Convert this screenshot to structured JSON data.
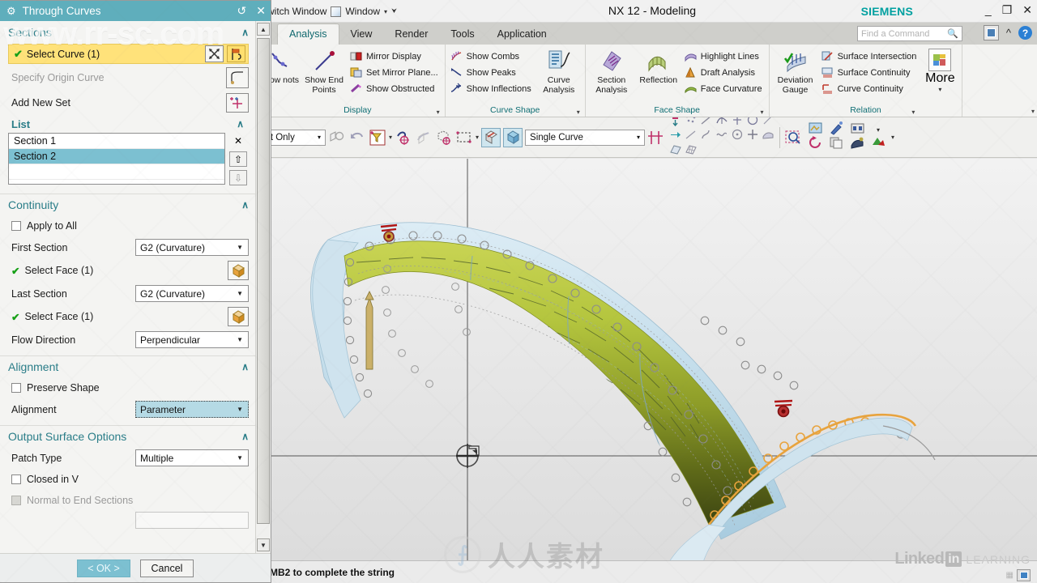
{
  "app": {
    "title": "NX 12 - Modeling",
    "brand": "SIEMENS",
    "minimize": "_",
    "restore": "❐",
    "close": "✕"
  },
  "quick_access": {
    "switch_window_label": "witch Window",
    "window_label": "Window",
    "dropdown_caret": "▾",
    "overflow_caret": "⮟"
  },
  "search": {
    "placeholder": "Find a Command",
    "icon": "search-icon"
  },
  "ribbon": {
    "tabs": [
      {
        "label": "Analysis",
        "active": true
      },
      {
        "label": "View",
        "active": false
      },
      {
        "label": "Render",
        "active": false
      },
      {
        "label": "Tools",
        "active": false
      },
      {
        "label": "Application",
        "active": false
      }
    ],
    "groups": [
      {
        "name": "Display",
        "big_buttons": [
          {
            "label": "how\nnots",
            "icon": "show-knots-icon"
          },
          {
            "label": "Show End\nPoints",
            "icon": "show-end-points-icon"
          }
        ],
        "small_buttons": [
          {
            "label": "Mirror Display",
            "icon": "mirror-display-icon"
          },
          {
            "label": "Set Mirror Plane...",
            "icon": "set-mirror-plane-icon"
          },
          {
            "label": "Show Obstructed",
            "icon": "show-obstructed-icon"
          }
        ]
      },
      {
        "name": "Curve Shape",
        "small_buttons": [
          {
            "label": "Show Combs",
            "icon": "show-combs-icon"
          },
          {
            "label": "Show Peaks",
            "icon": "show-peaks-icon"
          },
          {
            "label": "Show Inflections",
            "icon": "show-inflections-icon"
          }
        ],
        "big_buttons": [
          {
            "label": "Curve\nAnalysis",
            "icon": "curve-analysis-icon"
          }
        ]
      },
      {
        "name": "Face Shape",
        "big_buttons": [
          {
            "label": "Section\nAnalysis",
            "icon": "section-analysis-icon"
          },
          {
            "label": "Reflection",
            "icon": "reflection-icon"
          }
        ],
        "small_buttons": [
          {
            "label": "Highlight Lines",
            "icon": "highlight-lines-icon"
          },
          {
            "label": "Draft Analysis",
            "icon": "draft-analysis-icon"
          },
          {
            "label": "Face Curvature",
            "icon": "face-curvature-icon"
          }
        ]
      },
      {
        "name": "Relation",
        "big_buttons": [
          {
            "label": "Deviation\nGauge",
            "icon": "deviation-gauge-icon"
          }
        ],
        "small_buttons": [
          {
            "label": "Surface Intersection",
            "icon": "surface-intersection-icon"
          },
          {
            "label": "Surface Continuity",
            "icon": "surface-continuity-icon"
          },
          {
            "label": "Curve Continuity",
            "icon": "curve-continuity-icon"
          }
        ]
      }
    ],
    "more_label": "More",
    "group_expand_caret": "▾"
  },
  "toolbar": {
    "filter_value": "rt Only",
    "curve_rule_value": "Single Curve",
    "caret": "▾"
  },
  "dialog": {
    "title": "Through Curves",
    "title_icons": {
      "reset": "↺",
      "close": "✕",
      "gear": "⚙"
    },
    "sections": {
      "header": "Sections",
      "collapse_caret": "∧",
      "select_curve": {
        "label": "Select Curve (1)",
        "check": "✔"
      },
      "specify_origin_curve": "Specify Origin Curve",
      "add_new_set": "Add New Set",
      "list": {
        "header": "List",
        "collapse_caret": "∧",
        "items": [
          {
            "label": "Section  1",
            "selected": false
          },
          {
            "label": "Section  2",
            "selected": true
          }
        ],
        "buttons": [
          {
            "name": "remove",
            "glyph": "✕"
          },
          {
            "name": "move-up",
            "glyph": "⇧"
          },
          {
            "name": "move-down",
            "glyph": "⇩"
          }
        ]
      }
    },
    "continuity": {
      "header": "Continuity",
      "collapse_caret": "∧",
      "apply_to_all": {
        "label": "Apply to All",
        "checked": false
      },
      "first_section": {
        "label": "First Section",
        "value": "G2 (Curvature)"
      },
      "first_face": {
        "label": "Select Face (1)",
        "check": "✔"
      },
      "last_section": {
        "label": "Last Section",
        "value": "G2 (Curvature)"
      },
      "last_face": {
        "label": "Select Face (1)",
        "check": "✔"
      },
      "flow_direction": {
        "label": "Flow Direction",
        "value": "Perpendicular"
      }
    },
    "alignment": {
      "header": "Alignment",
      "collapse_caret": "∧",
      "preserve_shape": {
        "label": "Preserve Shape",
        "checked": false
      },
      "alignment": {
        "label": "Alignment",
        "value": "Parameter"
      }
    },
    "output_surface": {
      "header": "Output Surface Options",
      "collapse_caret": "∧",
      "patch_type": {
        "label": "Patch Type",
        "value": "Multiple"
      },
      "closed_in_v": {
        "label": "Closed in V",
        "checked": false
      },
      "normal_to_end_sections": {
        "label": "Normal to End Sections",
        "checked": false,
        "disabled": true
      }
    },
    "footer": {
      "ok": "< OK >",
      "cancel": "Cancel"
    }
  },
  "statusbar": {
    "message": "MB2 to complete the string"
  },
  "watermarks": {
    "url": "www.rr-sc.com",
    "chinese": "人人素材",
    "chinese_logo": "⨍",
    "linkedin_word": "Linked",
    "linkedin_in": "in",
    "linkedin_learning": "LEARNING"
  },
  "colors": {
    "dialog_title_bg": "#5faebc",
    "highlight_row": "#ffe27a",
    "list_selection": "#7cc0d1",
    "section_header_text": "#2a7d88",
    "siemens_teal": "#00a0a0",
    "surface_green": "#9aa82a",
    "surface_blue": "#bcd8e8",
    "edge_orange": "#e8a33d"
  },
  "viewport": {
    "model_name": "through-curves-surface",
    "datum_marker": "datum-csys-origin"
  }
}
